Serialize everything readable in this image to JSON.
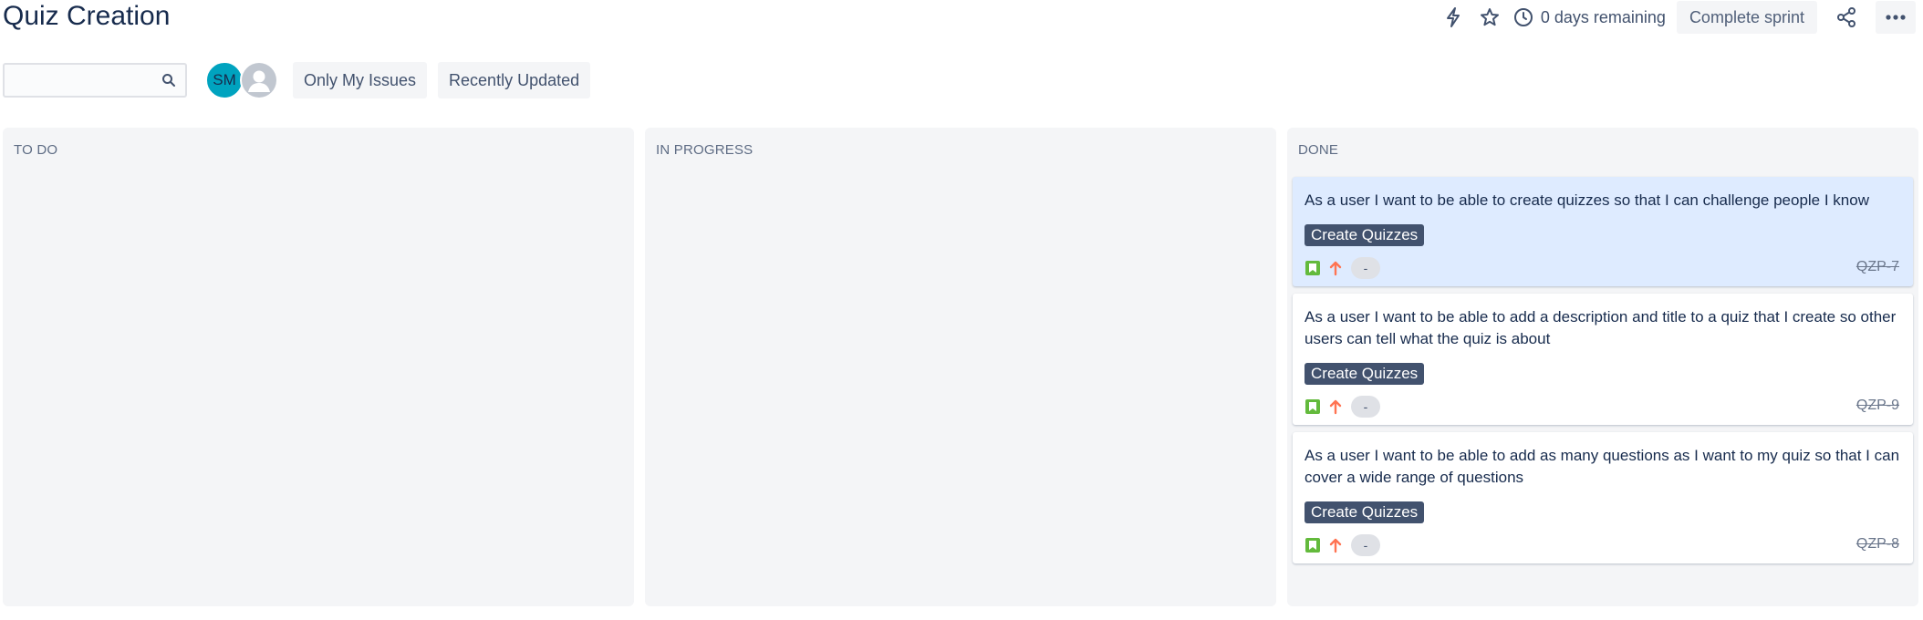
{
  "header": {
    "title": "Quiz Creation",
    "days_remaining": "0 days remaining",
    "complete_sprint_label": "Complete sprint"
  },
  "filters": {
    "search_placeholder": "",
    "avatar_initials": "SM",
    "quick_filters": [
      "Only My Issues",
      "Recently Updated"
    ]
  },
  "columns": [
    {
      "title": "TO DO",
      "cards": []
    },
    {
      "title": "IN PROGRESS",
      "cards": []
    },
    {
      "title": "DONE",
      "cards": [
        {
          "summary": "As a user I want to be able to create quizzes so that I can challenge people I know",
          "epic": "Create Quizzes",
          "estimate": "-",
          "key": "QZP-7",
          "selected": true
        },
        {
          "summary": "As a user I want to be able to add a description and title to a quiz that I create so other users can tell what the quiz is about",
          "epic": "Create Quizzes",
          "estimate": "-",
          "key": "QZP-9",
          "selected": false
        },
        {
          "summary": "As a user I want to be able to add as many questions as I want to my quiz so that I can cover a wide range of questions",
          "epic": "Create Quizzes",
          "estimate": "-",
          "key": "QZP-8",
          "selected": false
        }
      ]
    }
  ],
  "colors": {
    "epic_bg": "#42526e",
    "story_icon": "#63ba3c",
    "priority_high": "#ff7452",
    "selected_card": "#deebff",
    "avatar_sm": "#00a3bf"
  },
  "icons": {
    "header": [
      "lightning-icon",
      "star-icon",
      "clock-icon",
      "share-icon",
      "more-icon"
    ],
    "search": "search-icon",
    "card": [
      "story-icon",
      "priority-high-icon"
    ]
  }
}
